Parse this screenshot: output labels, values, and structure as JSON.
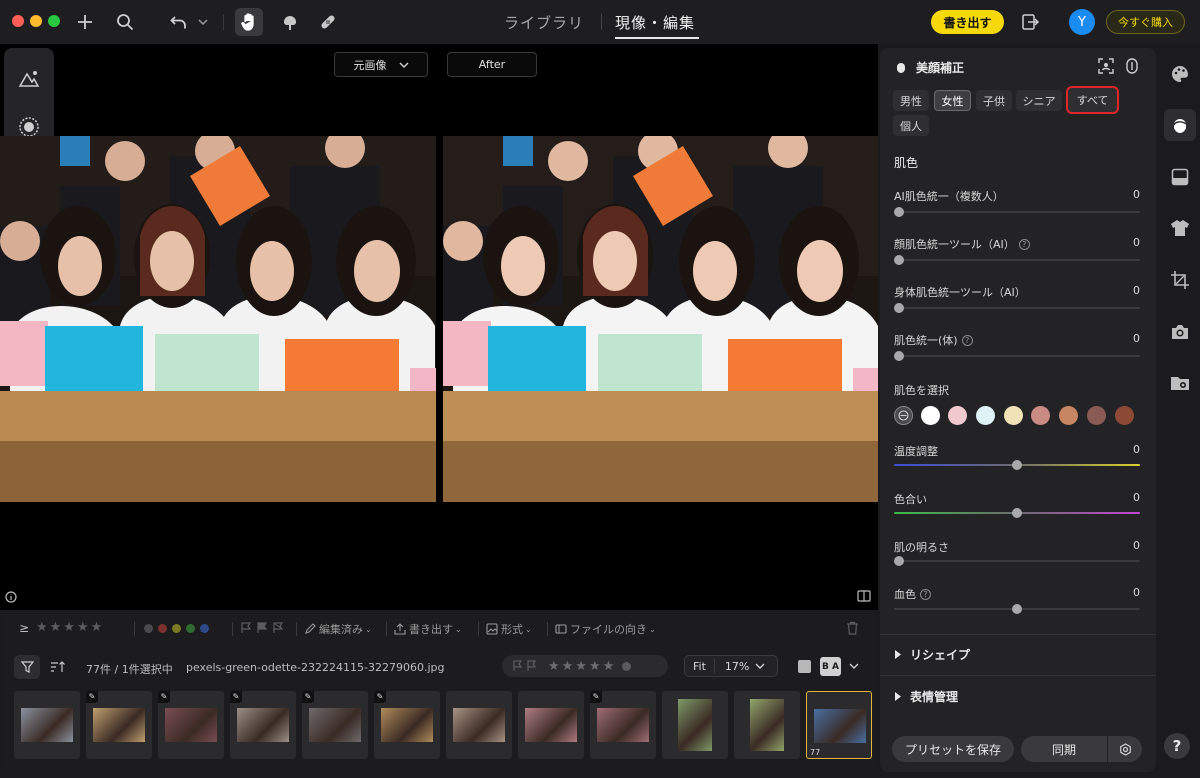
{
  "window": {
    "close_color": "#ff5f57",
    "minimize_color": "#febc2e",
    "zoom_color": "#28c840"
  },
  "nav": {
    "library_label": "ライブラリ",
    "develop_label": "現像・編集"
  },
  "toolbar": {
    "export_label": "書き出す",
    "buy_label": "今すぐ購入",
    "avatar_initial": "Y",
    "accent": "#f5d90a"
  },
  "viewer": {
    "before_label": "元画像",
    "after_label": "After"
  },
  "panel": {
    "title": "美顔補正",
    "gender_chips": [
      "男性",
      "女性",
      "子供",
      "シニア",
      "すべて"
    ],
    "individual_chip": "個人",
    "section_skin": "肌色",
    "sliders": [
      {
        "label": "AI肌色統一（複数人）",
        "value": "0",
        "level": 0
      },
      {
        "label": "顔肌色統一ツール（AI）",
        "value": "0",
        "level": 0
      },
      {
        "label": "身体肌色統一ツール（AI）",
        "value": "0",
        "level": 0
      },
      {
        "label": "肌色統一(体)",
        "value": "0",
        "level": 0
      }
    ],
    "pick_skin_label": "肌色を選択",
    "swatches": [
      "#ffffff",
      "#f0c9cf",
      "#dff3f7",
      "#f1e2b8",
      "#c98b84",
      "#c68661",
      "#8a5a55",
      "#8c4a36"
    ],
    "temp": {
      "label": "温度調整",
      "value": "0",
      "level": 0.5
    },
    "tint": {
      "label": "色合い",
      "value": "0",
      "level": 0.5
    },
    "brightness": {
      "label": "肌の明るさ",
      "value": "0",
      "level": 0
    },
    "blood": {
      "label": "血色",
      "value": "0",
      "level": 0.5
    },
    "reshape_label": "リシェイプ",
    "expression_label": "表情管理",
    "save_preset_label": "プリセットを保存",
    "sync_label": "同期"
  },
  "film": {
    "edited_label": "編集済み",
    "export_label": "書き出す",
    "format_label": "形式",
    "orientation_label": "ファイルの向き",
    "count_label": "77件 / 1件選択中",
    "filename": "pexels-green-odette-232224115-32279060.jpg",
    "fit_label": "Fit",
    "zoom_label": "17%",
    "ba_label": "B A",
    "selected_number": "77",
    "thumbs": [
      {
        "bg": "#8a93a0"
      },
      {
        "bg": "#c0a070"
      },
      {
        "bg": "#7a4d54"
      },
      {
        "bg": "#9c8f88"
      },
      {
        "bg": "#6e6a6c"
      },
      {
        "bg": "#b28c5c"
      },
      {
        "bg": "#a89484"
      },
      {
        "bg": "#b07c84"
      },
      {
        "bg": "#a06d76"
      },
      {
        "bg": "#7f9a68"
      },
      {
        "bg": "#93a66c"
      },
      {
        "bg": "#4a6fa4"
      }
    ]
  }
}
